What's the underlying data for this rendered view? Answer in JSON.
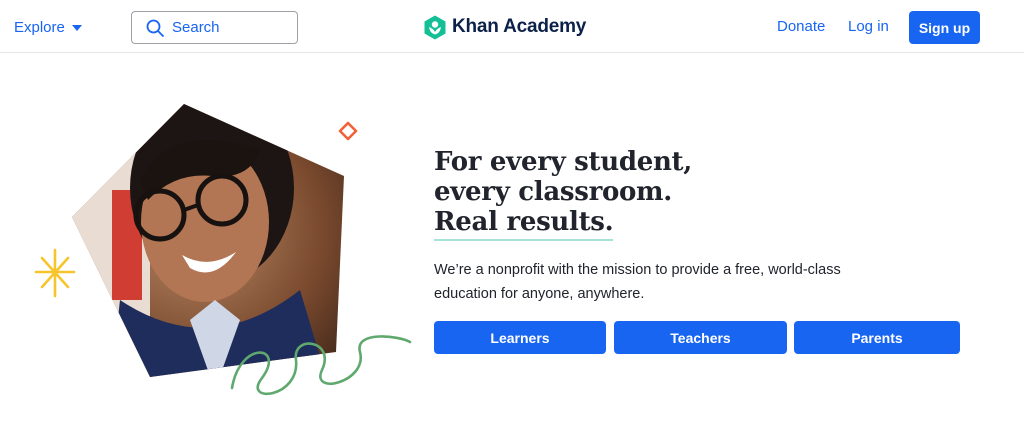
{
  "header": {
    "explore_label": "Explore",
    "search_label": "Search",
    "brand_name": "Khan Academy",
    "donate_label": "Donate",
    "login_label": "Log in",
    "signup_label": "Sign up"
  },
  "hero": {
    "headline_lines": [
      "For every student,",
      "every classroom.",
      "Real results."
    ],
    "mission": "We’re a nonprofit with the mission to provide a free, world-class education for anyone, anywhere.",
    "buttons": [
      "Learners",
      "Teachers",
      "Parents"
    ]
  },
  "colors": {
    "accent": "#1865f2",
    "brand_green": "#14bf96",
    "brand_navy": "#0b2149",
    "underline": "#a6e2d6",
    "diamond": "#f2623a",
    "spark": "#f7c52b",
    "squiggle": "#5fa96f"
  }
}
